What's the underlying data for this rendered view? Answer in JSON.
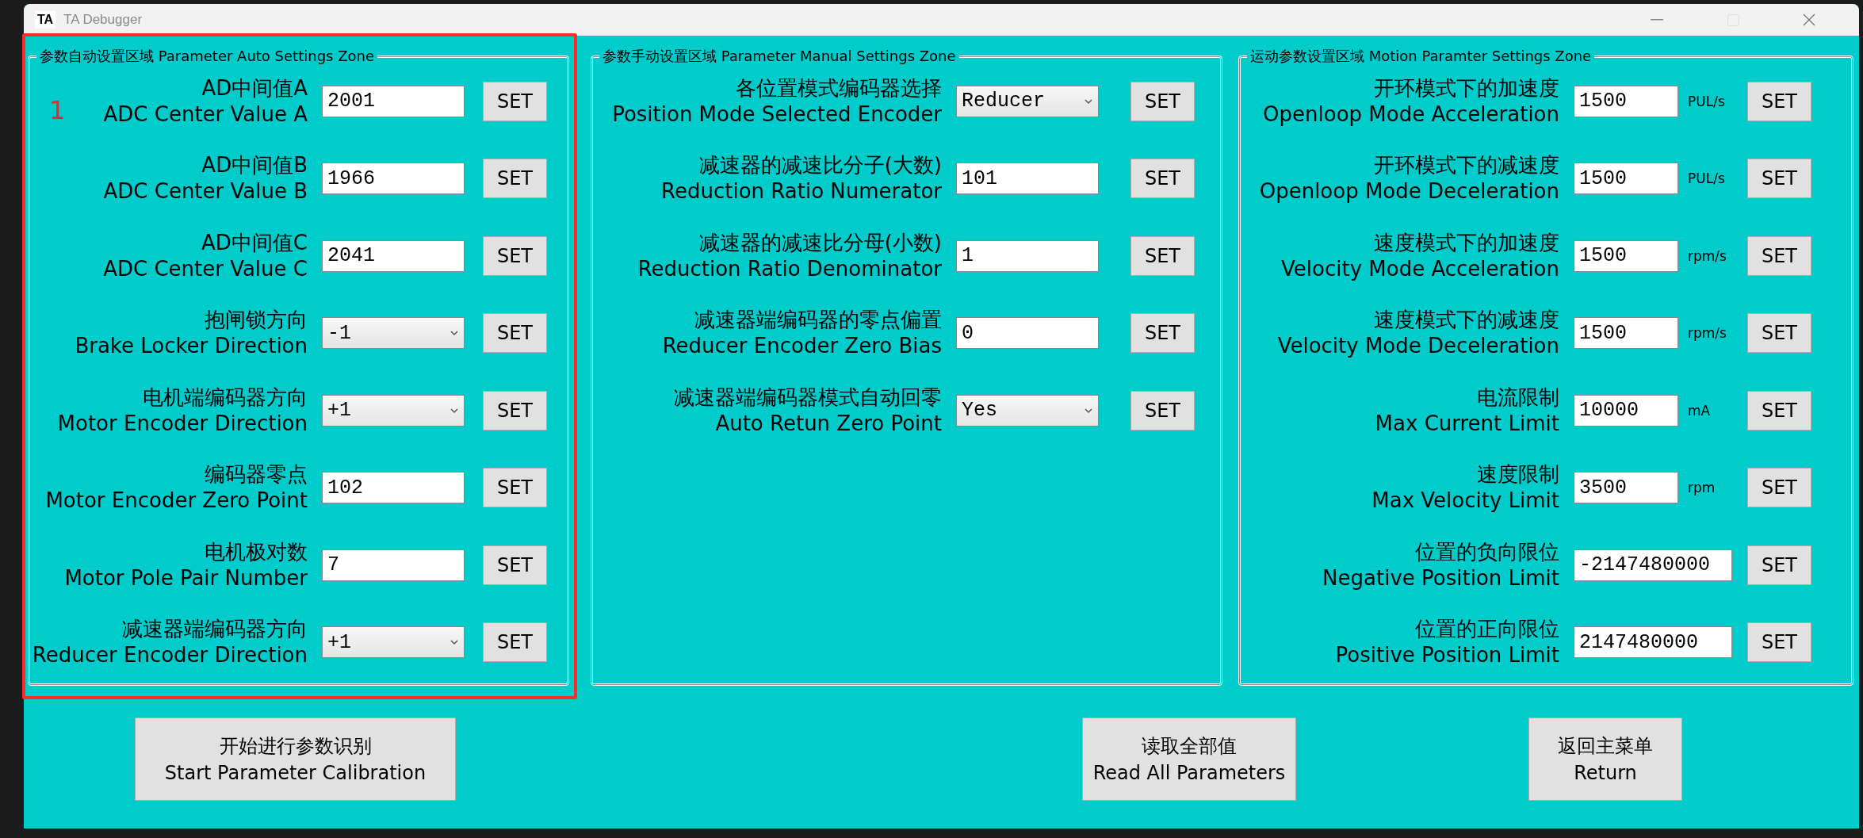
{
  "window": {
    "logo": "TA",
    "title": "TA Debugger"
  },
  "annotation": {
    "label": "1"
  },
  "panels": [
    {
      "title": "参数自动设置区域 Parameter Auto Settings Zone",
      "rows": [
        {
          "label_cn": "AD中间值A",
          "label_en": "ADC Center Value A",
          "kind": "input",
          "value": "2001",
          "button": "SET"
        },
        {
          "label_cn": "AD中间值B",
          "label_en": "ADC Center Value B",
          "kind": "input",
          "value": "1966",
          "button": "SET"
        },
        {
          "label_cn": "AD中间值C",
          "label_en": "ADC Center Value C",
          "kind": "input",
          "value": "2041",
          "button": "SET"
        },
        {
          "label_cn": "抱闸锁方向",
          "label_en": "Brake Locker Direction",
          "kind": "select",
          "value": "-1",
          "button": "SET"
        },
        {
          "label_cn": "电机端编码器方向",
          "label_en": "Motor Encoder Direction",
          "kind": "select",
          "value": "+1",
          "button": "SET"
        },
        {
          "label_cn": "编码器零点",
          "label_en": "Motor Encoder Zero Point",
          "kind": "input",
          "value": "102",
          "button": "SET"
        },
        {
          "label_cn": "电机极对数",
          "label_en": "Motor Pole Pair Number",
          "kind": "input",
          "value": "7",
          "button": "SET"
        },
        {
          "label_cn": "减速器端编码器方向",
          "label_en": "Reducer Encoder Direction",
          "kind": "select",
          "value": "+1",
          "button": "SET"
        }
      ]
    },
    {
      "title": "参数手动设置区域 Parameter Manual Settings Zone",
      "rows": [
        {
          "label_cn": "各位置模式编码器选择",
          "label_en": "Position Mode Selected Encoder",
          "kind": "select",
          "value": "Reducer",
          "button": "SET"
        },
        {
          "label_cn": "减速器的减速比分子(大数)",
          "label_en": "Reduction Ratio Numerator",
          "kind": "input",
          "value": "101",
          "button": "SET"
        },
        {
          "label_cn": "减速器的减速比分母(小数)",
          "label_en": "Reduction Ratio Denominator",
          "kind": "input",
          "value": "1",
          "button": "SET"
        },
        {
          "label_cn": "减速器端编码器的零点偏置",
          "label_en": "Reducer Encoder Zero Bias",
          "kind": "input",
          "value": "0",
          "button": "SET"
        },
        {
          "label_cn": "减速器端编码器模式自动回零",
          "label_en": "Auto Retun Zero Point",
          "kind": "select",
          "value": "Yes",
          "button": "SET"
        }
      ]
    },
    {
      "title": "运动参数设置区域 Motion Paramter Settings Zone",
      "rows": [
        {
          "label_cn": "开环模式下的加速度",
          "label_en": "Openloop Mode Acceleration",
          "kind": "input",
          "value": "1500",
          "unit": "PUL/s",
          "button": "SET"
        },
        {
          "label_cn": "开环模式下的减速度",
          "label_en": "Openloop Mode Deceleration",
          "kind": "input",
          "value": "1500",
          "unit": "PUL/s",
          "button": "SET"
        },
        {
          "label_cn": "速度模式下的加速度",
          "label_en": "Velocity Mode Acceleration",
          "kind": "input",
          "value": "1500",
          "unit": "rpm/s",
          "button": "SET"
        },
        {
          "label_cn": "速度模式下的减速度",
          "label_en": "Velocity Mode Deceleration",
          "kind": "input",
          "value": "1500",
          "unit": "rpm/s",
          "button": "SET"
        },
        {
          "label_cn": "电流限制",
          "label_en": "Max Current Limit",
          "kind": "input",
          "value": "10000",
          "unit": "mA",
          "button": "SET"
        },
        {
          "label_cn": "速度限制",
          "label_en": "Max Velocity Limit",
          "kind": "input",
          "value": "3500",
          "unit": "rpm",
          "button": "SET"
        },
        {
          "label_cn": "位置的负向限位",
          "label_en": "Negative Position Limit",
          "kind": "input",
          "value": "-2147480000",
          "button": "SET"
        },
        {
          "label_cn": "位置的正向限位",
          "label_en": "Positive Position Limit",
          "kind": "input",
          "value": "2147480000",
          "button": "SET"
        }
      ]
    }
  ],
  "buttons": [
    {
      "line1": "开始进行参数识别",
      "line2": "Start Parameter Calibration"
    },
    {
      "line1": "读取全部值",
      "line2": "Read All Parameters"
    },
    {
      "line1": "返回主菜单",
      "line2": "Return"
    }
  ]
}
